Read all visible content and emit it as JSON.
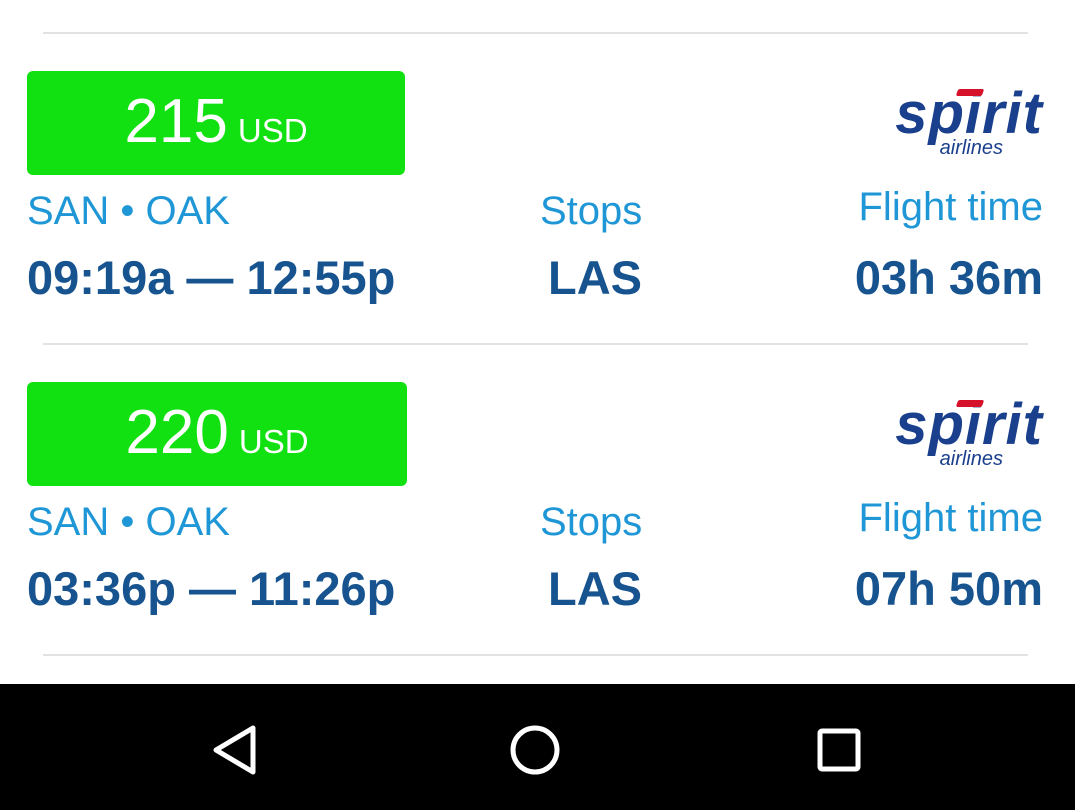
{
  "flights": [
    {
      "price": "215",
      "currency": "USD",
      "route": "SAN • OAK",
      "times": "09:19a — 12:55p",
      "stops_label": "Stops",
      "stops_value": "LAS",
      "flight_time_label": "Flight time",
      "flight_time_value": "03h 36m",
      "airline": {
        "name": "spirit",
        "sub": "airlines"
      }
    },
    {
      "price": "220",
      "currency": "USD",
      "route": "SAN • OAK",
      "times": "03:36p — 11:26p",
      "stops_label": "Stops",
      "stops_value": "LAS",
      "flight_time_label": "Flight time",
      "flight_time_value": "07h 50m",
      "airline": {
        "name": "spirit",
        "sub": "airlines"
      }
    }
  ],
  "colors": {
    "price_badge": "#11e011",
    "label_blue": "#1f97d6",
    "value_navy": "#16538f",
    "logo_navy": "#1a3f8c",
    "logo_red": "#d6112a",
    "navbar": "#000000"
  },
  "navbar": {
    "icons": [
      "back-icon",
      "home-icon",
      "recents-icon"
    ]
  }
}
